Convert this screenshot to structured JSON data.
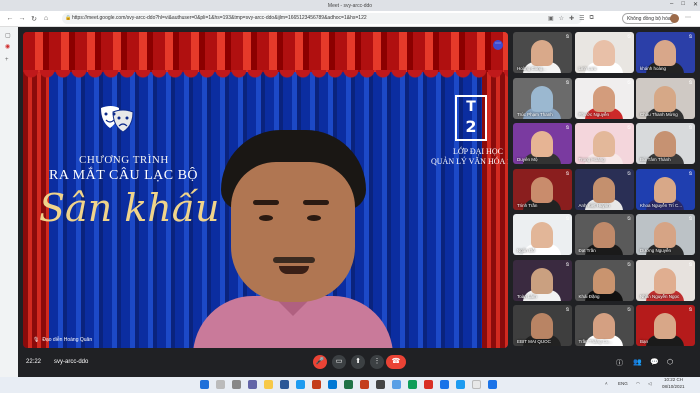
{
  "browser": {
    "title": "Meet - svy-arcc-ddo",
    "url": "https://meet.google.com/svy-arcc-ddo?hl=vi&authuser=0&pli=1&hs=193&tmp=svy-arcc-ddo&ijlm=1665123456789&adhoc=1&hs=122",
    "profile_button": "Không đồng bộ hóa"
  },
  "meeting": {
    "time": "22:22",
    "code": "svy-arcc-ddo"
  },
  "main_tile": {
    "program_line1": "CHƯƠNG TRÌNH",
    "program_line2": "RA MẮT CÂU LẠC BỘ",
    "program_line3": "Sân khấu",
    "class_line1": "LỚP ĐẠI HỌC",
    "class_line2": "QUẢN LÝ VĂN HÓA 15...",
    "logo_top": "T",
    "logo_bottom": "2",
    "speaker_name": "Đạo diễn Hoàng Quân"
  },
  "participants": [
    {
      "name": "Hoàng Công...",
      "bg": "#4a4a4a",
      "skin": "#d9a98a",
      "shirt": "#f4f4f4"
    },
    {
      "name": "Linh Lưu",
      "bg": "#e9e6e2",
      "skin": "#e8c0a8",
      "shirt": "#ffffff"
    },
    {
      "name": "khánh hoàng",
      "bg": "#2b3fa8",
      "skin": "#d8a78a",
      "shirt": "#222222"
    },
    {
      "name": "Trúc Phạm Thanh",
      "bg": "#6b6b6b",
      "skin": "#9bb8d0",
      "shirt": "#8aa4c0"
    },
    {
      "name": "Phước Nguyễn",
      "bg": "#f0eeee",
      "skin": "#d39c7c",
      "shirt": "#cc2a2a"
    },
    {
      "name": "Châu Thanh Mừng",
      "bg": "#cfc9c4",
      "skin": "#d6a887",
      "shirt": "#333333"
    },
    {
      "name": "Duyên Mộ",
      "bg": "#7a3aa0",
      "skin": "#e6b494",
      "shirt": "#333333"
    },
    {
      "name": "Trọng Hoàng",
      "bg": "#f4d6dc",
      "skin": "#e3b89a",
      "shirt": "#f7e9e9"
    },
    {
      "name": "Bùi Tâm Thành",
      "bg": "#d8dadc",
      "skin": "#c69272",
      "shirt": "#3a3a3a"
    },
    {
      "name": "Trinh Trần",
      "bg": "#8a1e1e",
      "skin": "#c98c6c",
      "shirt": "#222222"
    },
    {
      "name": "Anh Kiệt Huỳnh",
      "bg": "#2a2f55",
      "skin": "#c4906e",
      "shirt": "#e8e8e8"
    },
    {
      "name": "Khoa Nguyễn Trí C...",
      "bg": "#1f3fb0",
      "skin": "#d8a888",
      "shirt": "#2a2a6a"
    },
    {
      "name": "Ngân Đỗ",
      "bg": "#eceff1",
      "skin": "#e2b698",
      "shirt": "#ffffff"
    },
    {
      "name": "Đạt Trần",
      "bg": "#5a5a5a",
      "skin": "#c08a6a",
      "shirt": "#1a1a1a"
    },
    {
      "name": "Dương Nguyễn",
      "bg": "#bcc2c6",
      "skin": "#d6a485",
      "shirt": "#2a2a2a"
    },
    {
      "name": "Toàn Lâm",
      "bg": "#3a2a40",
      "skin": "#caa080",
      "shirt": "#f2f2f2"
    },
    {
      "name": "Khải Đặng",
      "bg": "#555555",
      "skin": "#c9946f",
      "shirt": "#111111"
    },
    {
      "name": "Nhân Nguyễn Ngọc",
      "bg": "#e7e2de",
      "skin": "#e0ae90",
      "shirt": "#c03030"
    },
    {
      "name": "EBIT MAI QUOC",
      "bg": "#3e3e3e",
      "skin": "#b98464",
      "shirt": "#222222"
    },
    {
      "name": "Trần Thắng Cu...",
      "bg": "#4a4a4a",
      "skin": "#d4a082",
      "shirt": "#ffffff"
    },
    {
      "name": "Bạn",
      "bg": "#b51b1b",
      "skin": "#d8a788",
      "shirt": "#1a1a1a"
    }
  ],
  "taskbar": {
    "lang": "ENG",
    "time": "10:22 CH",
    "date": "08/10/2021"
  },
  "colors": {
    "meet_bg": "#202124",
    "hangup": "#ea4335",
    "stage_blue": "#0d2a8a",
    "curtain_red": "#c0191b"
  }
}
